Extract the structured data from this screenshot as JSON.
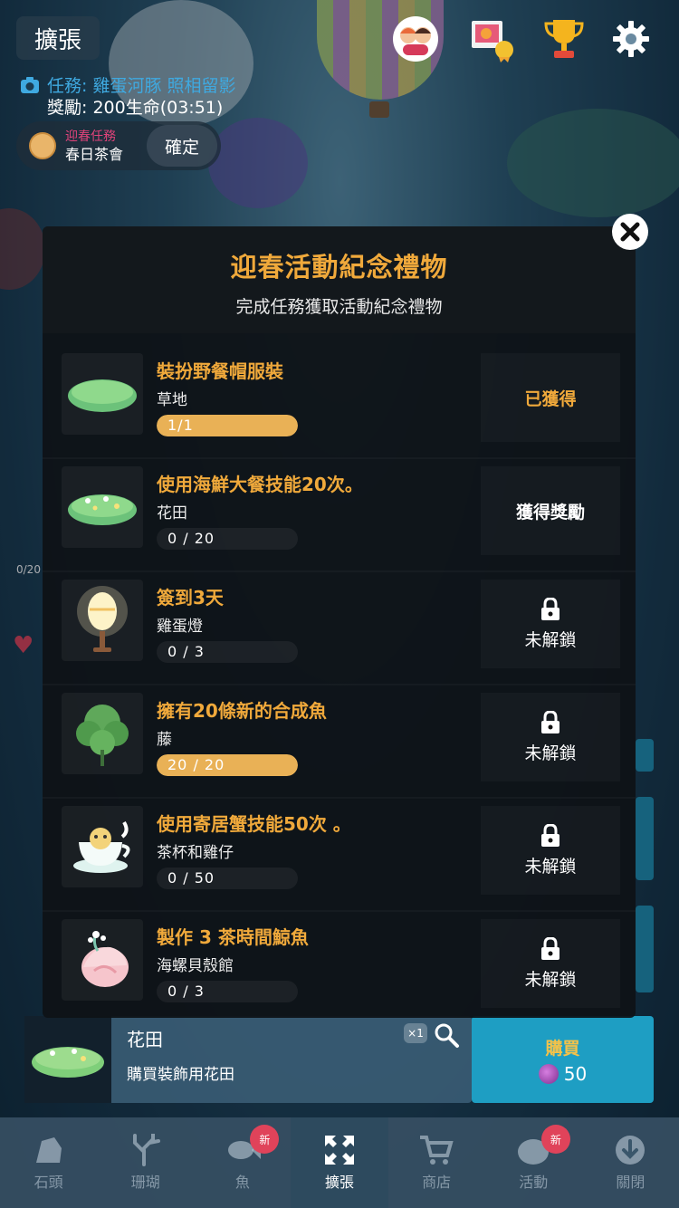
{
  "hud": {
    "expand_label": "擴張",
    "mission_text": "任務: 雞蛋河豚 照相留影",
    "reward_text": "獎勵: 200生命(03:51)",
    "mission_pill_tag": "迎春任務",
    "mission_pill_name": "春日茶會",
    "confirm_label": "確定",
    "icons": [
      "friends-icon",
      "album-icon",
      "trophy-icon",
      "gear-icon"
    ]
  },
  "modal": {
    "title": "迎春活動紀念禮物",
    "subtitle": "完成任務獲取活動紀念禮物",
    "tasks": [
      {
        "title": "裝扮野餐帽服裝",
        "item": "草地",
        "progress": "1/1",
        "fill": 1.0,
        "status": "已獲得",
        "state": "earned"
      },
      {
        "title": "使用海鮮大餐技能20次。",
        "item": "花田",
        "progress": "0 / 20",
        "fill": 0.0,
        "status": "獲得獎勵",
        "state": "claim"
      },
      {
        "title": "簽到3天",
        "item": "雞蛋燈",
        "progress": "0 / 3",
        "fill": 0.0,
        "status": "未解鎖",
        "state": "locked"
      },
      {
        "title": "擁有20條新的合成魚",
        "item": "藤",
        "progress": "20 / 20",
        "fill": 1.0,
        "status": "未解鎖",
        "state": "locked"
      },
      {
        "title": "使用寄居蟹技能50次 。",
        "item": "茶杯和雞仔",
        "progress": "0 / 50",
        "fill": 0.0,
        "status": "未解鎖",
        "state": "locked"
      },
      {
        "title": "製作 3 茶時間鯨魚",
        "item": "海螺貝殼館",
        "progress": "0 / 3",
        "fill": 0.0,
        "status": "未解鎖",
        "state": "locked"
      }
    ]
  },
  "shop_item": {
    "name": "花田",
    "description": "購買裝飾用花田",
    "quantity": "×1",
    "buy_label": "購買",
    "price": "50"
  },
  "side": {
    "counter": "0/20"
  },
  "nav": {
    "items": [
      {
        "label": "石頭",
        "badge": ""
      },
      {
        "label": "珊瑚",
        "badge": ""
      },
      {
        "label": "魚",
        "badge": "新"
      },
      {
        "label": "擴張",
        "badge": ""
      },
      {
        "label": "商店",
        "badge": ""
      },
      {
        "label": "活動",
        "badge": "新"
      },
      {
        "label": "關閉",
        "badge": ""
      }
    ]
  },
  "colors": {
    "accent_gold": "#f0a93b",
    "progress_fill": "#e9b156",
    "buy_button": "#1e9ec3",
    "badge_red": "#e0435a"
  }
}
